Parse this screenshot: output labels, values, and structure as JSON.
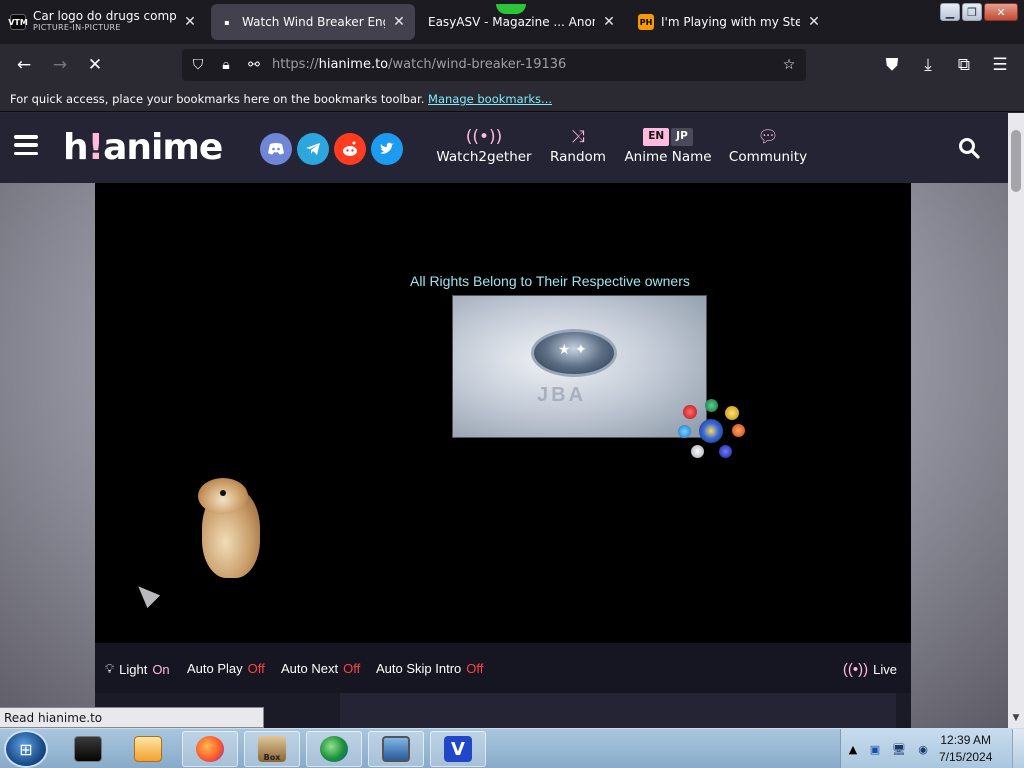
{
  "tabs": [
    {
      "title": "Car logo do drugs comparas",
      "subtitle": "PICTURE-IN-PICTURE",
      "favicon": "VTM"
    },
    {
      "title": "Watch Wind Breaker English",
      "favicon": "▪"
    },
    {
      "title": "EasyASV - Magazine ... Anonym",
      "favicon": ""
    },
    {
      "title": "I'm Playing with my Stepsist",
      "favicon": "PH"
    }
  ],
  "navbar": {
    "url_prefix": "https://",
    "url_domain": "hianime.to",
    "url_path": "/watch/wind-breaker-19136"
  },
  "bookmarks": {
    "text": "For quick access, place your bookmarks here on the bookmarks toolbar.",
    "link": "Manage bookmarks..."
  },
  "site": {
    "logo_left": "h",
    "logo_bang": "!",
    "logo_right": "anime",
    "nav": [
      {
        "label": "Watch2gether",
        "icon": "broadcast-icon"
      },
      {
        "label": "Random",
        "icon": "shuffle-icon"
      },
      {
        "label": "Anime Name",
        "icon": "language-toggle"
      },
      {
        "label": "Community",
        "icon": "chat-bubbles-icon"
      }
    ],
    "lang_en": "EN",
    "lang_jp": "JP",
    "socials": [
      "discord-icon",
      "telegram-icon",
      "reddit-icon",
      "twitter-icon"
    ]
  },
  "player": {
    "rights_text": "All Rights Belong to Their Respective owners",
    "video_watermark": "JBA"
  },
  "controls": {
    "light_label": "Light",
    "light_value": "On",
    "autoplay_label": "Auto Play",
    "autoplay_value": "Off",
    "autonext_label": "Auto Next",
    "autonext_value": "Off",
    "autoskip_label": "Auto Skip Intro",
    "autoskip_value": "Off",
    "live_label": "Live"
  },
  "status_text": "Read hianime.to",
  "taskbar": {
    "time": "12:39 AM",
    "date": "7/15/2024",
    "apps": [
      "terminal-app",
      "media-player-app",
      "firefox-app",
      "box-app",
      "download-manager-app",
      "tv-app",
      "v-app"
    ],
    "v_label": "V",
    "box_label": "Box"
  },
  "colors": {
    "accent": "#ffbade",
    "off": "#ff4444",
    "header_bg": "#242434"
  }
}
